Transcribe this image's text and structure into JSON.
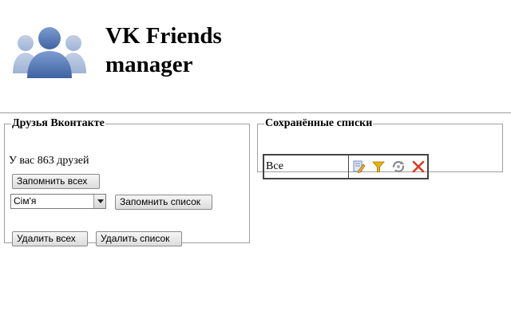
{
  "header": {
    "logo_icon": "people-group-icon",
    "title_line1": "VK Friends",
    "title_line2": "manager"
  },
  "friends_panel": {
    "legend": "Друзья Вконтакте",
    "count_prefix": "У вас",
    "count": "863",
    "count_suffix": "друзей",
    "save_all_label": "Запомнить всех",
    "group_select": {
      "selected": "Сім'я"
    },
    "save_list_label": "Запомнить список",
    "delete_all_label": "Удалить всех",
    "delete_list_label": "Удалить список"
  },
  "lists_panel": {
    "legend": "Сохранённые списки",
    "lists": [
      {
        "name": "Все",
        "actions": [
          "edit-icon",
          "filter-icon",
          "sync-icon",
          "delete-icon"
        ]
      }
    ]
  },
  "colors": {
    "logo_blue": "#4a6ea9",
    "delete_red": "#e03a1e",
    "filter_yellow": "#e8b400"
  }
}
